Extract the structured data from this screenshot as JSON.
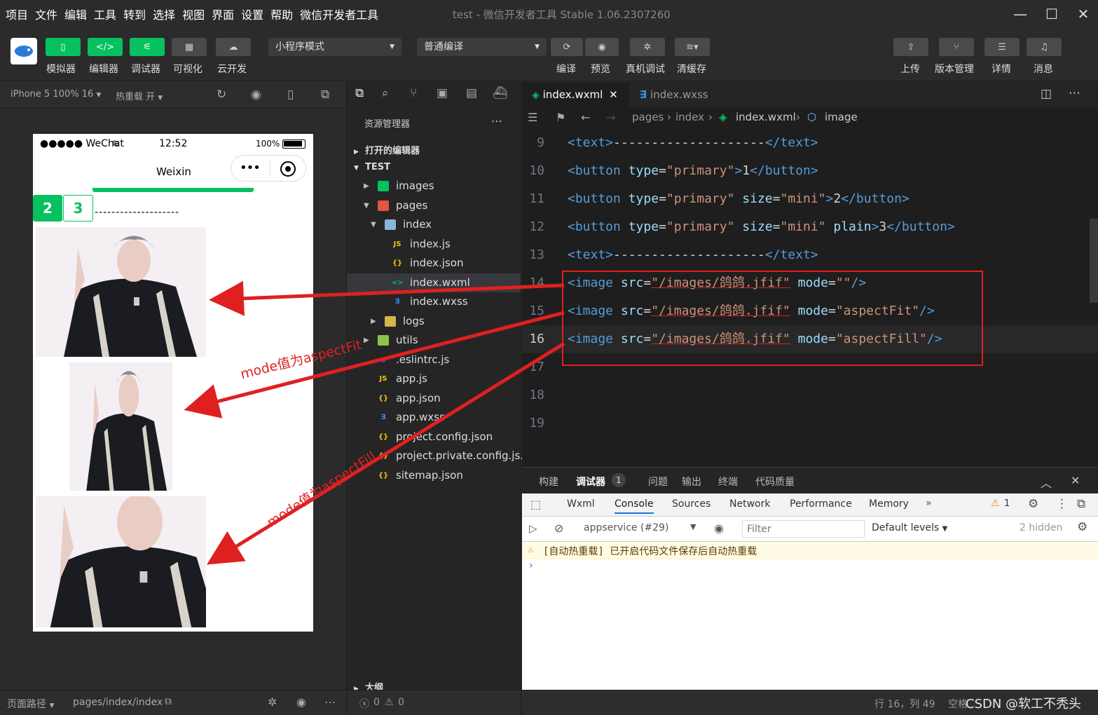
{
  "menu": [
    "项目",
    "文件",
    "编辑",
    "工具",
    "转到",
    "选择",
    "视图",
    "界面",
    "设置",
    "帮助",
    "微信开发者工具"
  ],
  "window_title": "test - 微信开发者工具 Stable 1.06.2307260",
  "toolbar": {
    "simulator": "模拟器",
    "editor": "编辑器",
    "debugger": "调试器",
    "visual": "可视化",
    "cloud": "云开发",
    "mode_select": "小程序模式",
    "compile_select": "普通编译",
    "compile": "编译",
    "preview": "预览",
    "remote_debug": "真机调试",
    "clear_cache": "清缓存",
    "upload": "上传",
    "version": "版本管理",
    "details": "详情",
    "messages": "消息"
  },
  "sim": {
    "device": "iPhone 5 100% 16",
    "hotreload": "热重载 开",
    "status_carrier": "●●●●● WeChat",
    "status_time": "12:52",
    "status_battery": "100%",
    "nav_title": "Weixin",
    "btn2": "2",
    "btn3": "3",
    "divider_text": "--------------------",
    "footer_path_label": "页面路径",
    "footer_path": "pages/index/index"
  },
  "annotations": {
    "fit": "mode值为aspectFit",
    "fill": "mode值为aspectFill"
  },
  "explorer": {
    "title": "资源管理器",
    "open_editors": "打开的编辑器",
    "project": "TEST",
    "outline": "大纲",
    "problems": "0",
    "warnings": "0",
    "items": [
      "images",
      "pages",
      "index",
      "index.js",
      "index.json",
      "index.wxml",
      "index.wxss",
      "logs",
      "utils",
      ".eslintrc.js",
      "app.js",
      "app.json",
      "app.wxss",
      "project.config.json",
      "project.private.config.js...",
      "sitemap.json"
    ]
  },
  "editor": {
    "tab1": "index.wxml",
    "tab2": "index.wxss",
    "crumbs": [
      "pages",
      "index",
      "index.wxml",
      "image"
    ],
    "lines": [
      {
        "n": "9",
        "c": [
          [
            "tg",
            "<text>"
          ],
          [
            "tx",
            "--------------------"
          ],
          [
            "tg",
            "</text>"
          ]
        ]
      },
      {
        "n": "10",
        "c": [
          [
            "tg",
            "<button "
          ],
          [
            "at",
            "type"
          ],
          [
            "tx",
            "="
          ],
          [
            "st",
            "\"primary\""
          ],
          [
            "tg",
            ">"
          ],
          [
            "tx",
            "1"
          ],
          [
            "tg",
            "</button>"
          ]
        ]
      },
      {
        "n": "11",
        "c": [
          [
            "tg",
            "<button "
          ],
          [
            "at",
            "type"
          ],
          [
            "tx",
            "="
          ],
          [
            "st",
            "\"primary\""
          ],
          [
            "tx",
            " "
          ],
          [
            "at",
            "size"
          ],
          [
            "tx",
            "="
          ],
          [
            "st",
            "\"mini\""
          ],
          [
            "tg",
            ">"
          ],
          [
            "tx",
            "2"
          ],
          [
            "tg",
            "</button>"
          ]
        ]
      },
      {
        "n": "12",
        "c": [
          [
            "tg",
            "<button "
          ],
          [
            "at",
            "type"
          ],
          [
            "tx",
            "="
          ],
          [
            "st",
            "\"primary\""
          ],
          [
            "tx",
            " "
          ],
          [
            "at",
            "size"
          ],
          [
            "tx",
            "="
          ],
          [
            "st",
            "\"mini\""
          ],
          [
            "tx",
            " "
          ],
          [
            "at",
            "plain"
          ],
          [
            "tg",
            ">"
          ],
          [
            "tx",
            "3"
          ],
          [
            "tg",
            "</button>"
          ]
        ]
      },
      {
        "n": "13",
        "c": [
          [
            "tg",
            "<text>"
          ],
          [
            "tx",
            "--------------------"
          ],
          [
            "tg",
            "</text>"
          ]
        ]
      },
      {
        "n": "14",
        "c": [
          [
            "tg",
            "<image "
          ],
          [
            "at",
            "src"
          ],
          [
            "tx",
            "="
          ],
          [
            "st",
            "\"/images/鸽鸽.jfif\""
          ],
          [
            "tx",
            " "
          ],
          [
            "at",
            "mode"
          ],
          [
            "tx",
            "="
          ],
          [
            "st",
            "\"\""
          ],
          [
            "tg",
            "/>"
          ]
        ]
      },
      {
        "n": "15",
        "c": [
          [
            "tg",
            "<image "
          ],
          [
            "at",
            "src"
          ],
          [
            "tx",
            "="
          ],
          [
            "st",
            "\"/images/鸽鸽.jfif\""
          ],
          [
            "tx",
            " "
          ],
          [
            "at",
            "mode"
          ],
          [
            "tx",
            "="
          ],
          [
            "st",
            "\"aspectFit\""
          ],
          [
            "tg",
            "/>"
          ]
        ]
      },
      {
        "n": "16",
        "c": [
          [
            "tg",
            "<image "
          ],
          [
            "at",
            "src"
          ],
          [
            "tx",
            "="
          ],
          [
            "st",
            "\"/images/鸽鸽.jfif\""
          ],
          [
            "tx",
            " "
          ],
          [
            "at",
            "mode"
          ],
          [
            "tx",
            "="
          ],
          [
            "st",
            "\"aspectFill\""
          ],
          [
            "tg",
            "/>"
          ]
        ]
      },
      {
        "n": "17",
        "c": []
      },
      {
        "n": "18",
        "c": []
      },
      {
        "n": "19",
        "c": []
      }
    ]
  },
  "devtools": {
    "tabs": [
      "构建",
      "调试器",
      "问题",
      "输出",
      "终端",
      "代码质量"
    ],
    "badge": "1",
    "inner_tabs": [
      "Wxml",
      "Console",
      "Sources",
      "Network",
      "Performance",
      "Memory"
    ],
    "warn_count": "1",
    "context": "appservice (#29)",
    "filter_placeholder": "Filter",
    "levels": "Default levels",
    "hidden": "2 hidden",
    "message": "[自动热重载] 已开启代码文件保存后自动热重载"
  },
  "statusbar": {
    "position": "行 16，列 49",
    "spaces": "空格",
    "watermark": "CSDN @软工不秃头"
  }
}
